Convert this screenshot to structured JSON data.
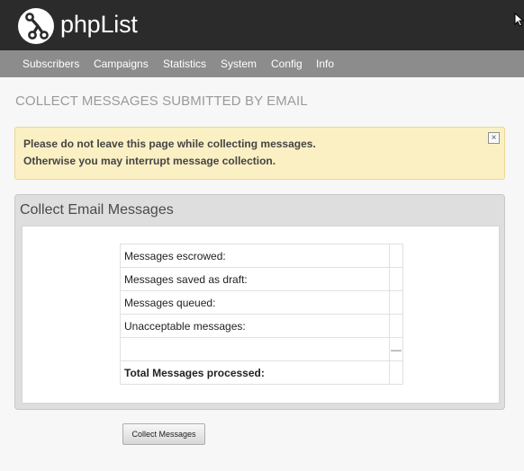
{
  "brand": {
    "name": "phpList",
    "logo_icon": "phplist-logo-icon"
  },
  "nav": {
    "items": [
      {
        "label": "Subscribers"
      },
      {
        "label": "Campaigns"
      },
      {
        "label": "Statistics"
      },
      {
        "label": "System"
      },
      {
        "label": "Config"
      },
      {
        "label": "Info"
      }
    ]
  },
  "page": {
    "title": "COLLECT MESSAGES SUBMITTED BY EMAIL"
  },
  "notice": {
    "line1": "Please do not leave this page while collecting messages.",
    "line2": "Otherwise you may interrupt message collection.",
    "close_label": "×",
    "close_icon": "close-icon"
  },
  "panel": {
    "title": "Collect Email Messages",
    "rows": [
      {
        "label": "Messages escrowed:",
        "value": ""
      },
      {
        "label": "Messages saved as draft:",
        "value": ""
      },
      {
        "label": "Messages queued:",
        "value": ""
      },
      {
        "label": "Unacceptable messages:",
        "value": ""
      },
      {
        "label": "",
        "value": "—"
      },
      {
        "label": "Total Messages processed:",
        "value": ""
      }
    ]
  },
  "actions": {
    "collect_label": "Collect Messages"
  },
  "colors": {
    "header_bg": "#2b2b2b",
    "nav_bg": "#8c8c8c",
    "notice_bg": "#fbf0c4",
    "panel_bg": "#dedede"
  }
}
